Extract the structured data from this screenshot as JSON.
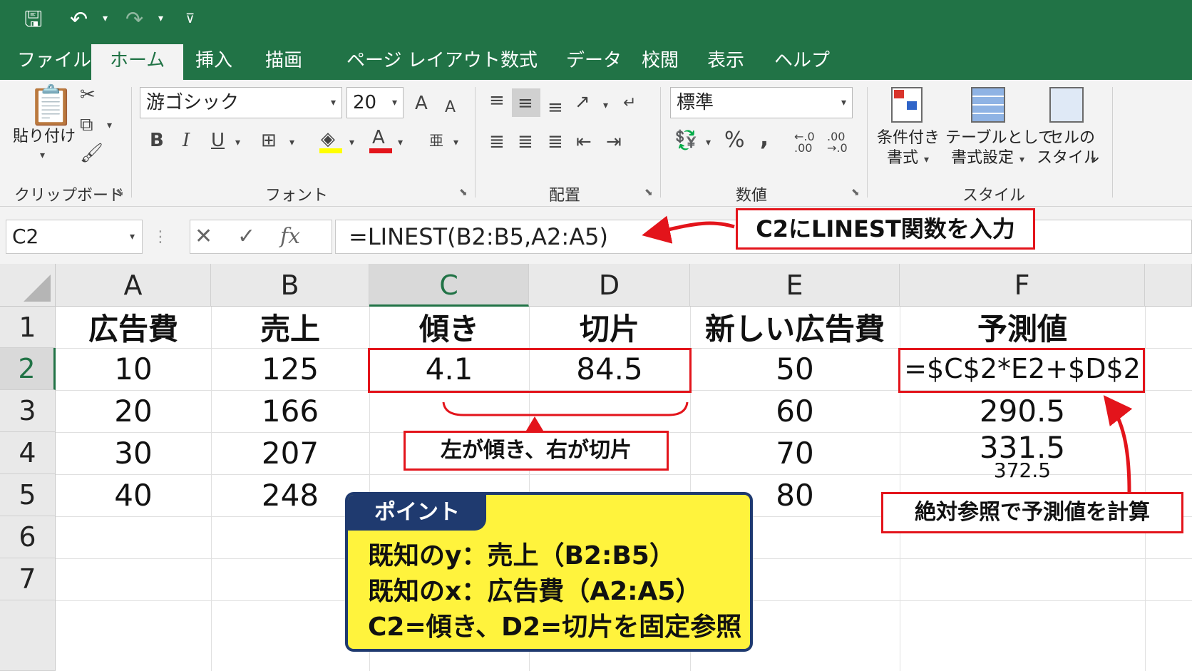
{
  "quick_access": {
    "save_icon": "save-icon",
    "undo_icon": "undo-icon",
    "redo_icon": "redo-icon",
    "customize_icon": "customize-qat-icon"
  },
  "tabs": [
    "ファイル",
    "ホーム",
    "挿入",
    "描画",
    "ページ レイアウト",
    "数式",
    "データ",
    "校閲",
    "表示",
    "ヘルプ"
  ],
  "active_tab": "ホーム",
  "ribbon": {
    "clipboard": {
      "label": "クリップボード",
      "paste_label": "貼り付け"
    },
    "font": {
      "label": "フォント",
      "font_name": "游ゴシック",
      "font_size": "20",
      "grow": "A",
      "shrink": "A",
      "bold": "B",
      "italic": "I",
      "underline": "U"
    },
    "alignment": {
      "label": "配置"
    },
    "number": {
      "label": "数値",
      "format": "標準",
      "percent": "%",
      "comma": ","
    },
    "styles": {
      "label": "スタイル",
      "conditional_line1": "条件付き",
      "conditional_line2": "書式",
      "table_line1": "テーブルとして",
      "table_line2": "書式設定",
      "cell_line1": "セルの",
      "cell_line2": "スタイル"
    }
  },
  "formula_bar": {
    "name_box": "C2",
    "cancel": "✕",
    "enter": "✓",
    "fx": "fx",
    "formula": "=LINEST(B2:B5,A2:A5)"
  },
  "columns": [
    "A",
    "B",
    "C",
    "D",
    "E",
    "F"
  ],
  "rows": [
    "1",
    "2",
    "3",
    "4",
    "5",
    "6",
    "7"
  ],
  "cells": {
    "A1": "広告費",
    "B1": "売上",
    "C1": "傾き",
    "D1": "切片",
    "E1": "新しい広告費",
    "F1": "予測値",
    "A2": "10",
    "B2": "125",
    "C2": "4.1",
    "D2": "84.5",
    "E2": "50",
    "F2": "=$C$2*E2+$D$2",
    "A3": "20",
    "B3": "166",
    "E3": "60",
    "F3": "290.5",
    "A4": "30",
    "B4": "207",
    "E4": "70",
    "F4": "331.5",
    "A5": "40",
    "B5": "248",
    "E5": "80",
    "F5": "372.5"
  },
  "annotations": {
    "linest_callout": "C2にLINEST関数を入力",
    "slope_callout": "左が傾き、右が切片",
    "abs_callout": "絶対参照で予測値を計算",
    "accent_color": "#e3141b"
  },
  "point_box": {
    "tag": "ポイント",
    "line1": "既知のy：売上（B2:B5）",
    "line2": "既知のx：広告費（A2:A5）",
    "line3": "C2=傾き、D2=切片を固定参照",
    "bg_color": "#fff33d",
    "tag_color": "#1f3a6f"
  }
}
